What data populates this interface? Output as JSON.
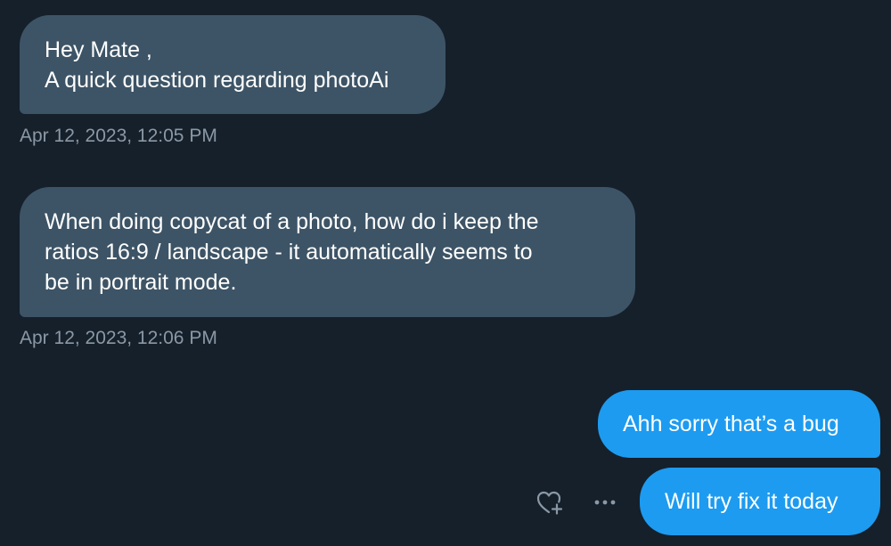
{
  "messages": [
    {
      "direction": "incoming",
      "lines": [
        "Hey Mate ,",
        "A quick question regarding photoAi"
      ],
      "timestamp": "Apr 12, 2023, 12:05 PM"
    },
    {
      "direction": "incoming",
      "lines": [
        "When doing copycat of a photo, how do i keep the",
        "ratios 16:9 / landscape - it automatically seems to",
        "be in portrait mode."
      ],
      "timestamp": "Apr 12, 2023, 12:06 PM"
    },
    {
      "direction": "outgoing",
      "text": "Ahh sorry that’s a bug"
    },
    {
      "direction": "outgoing",
      "text": "Will try fix it today"
    }
  ],
  "message_actions": {
    "react_icon": "heart-plus-icon",
    "more_icon": "more-dots-icon"
  },
  "colors": {
    "background": "#15202b",
    "incoming_bubble": "#3d5466",
    "outgoing_bubble": "#1d9bf0",
    "timestamp_text": "#8b98a5",
    "message_text": "#ffffff"
  }
}
